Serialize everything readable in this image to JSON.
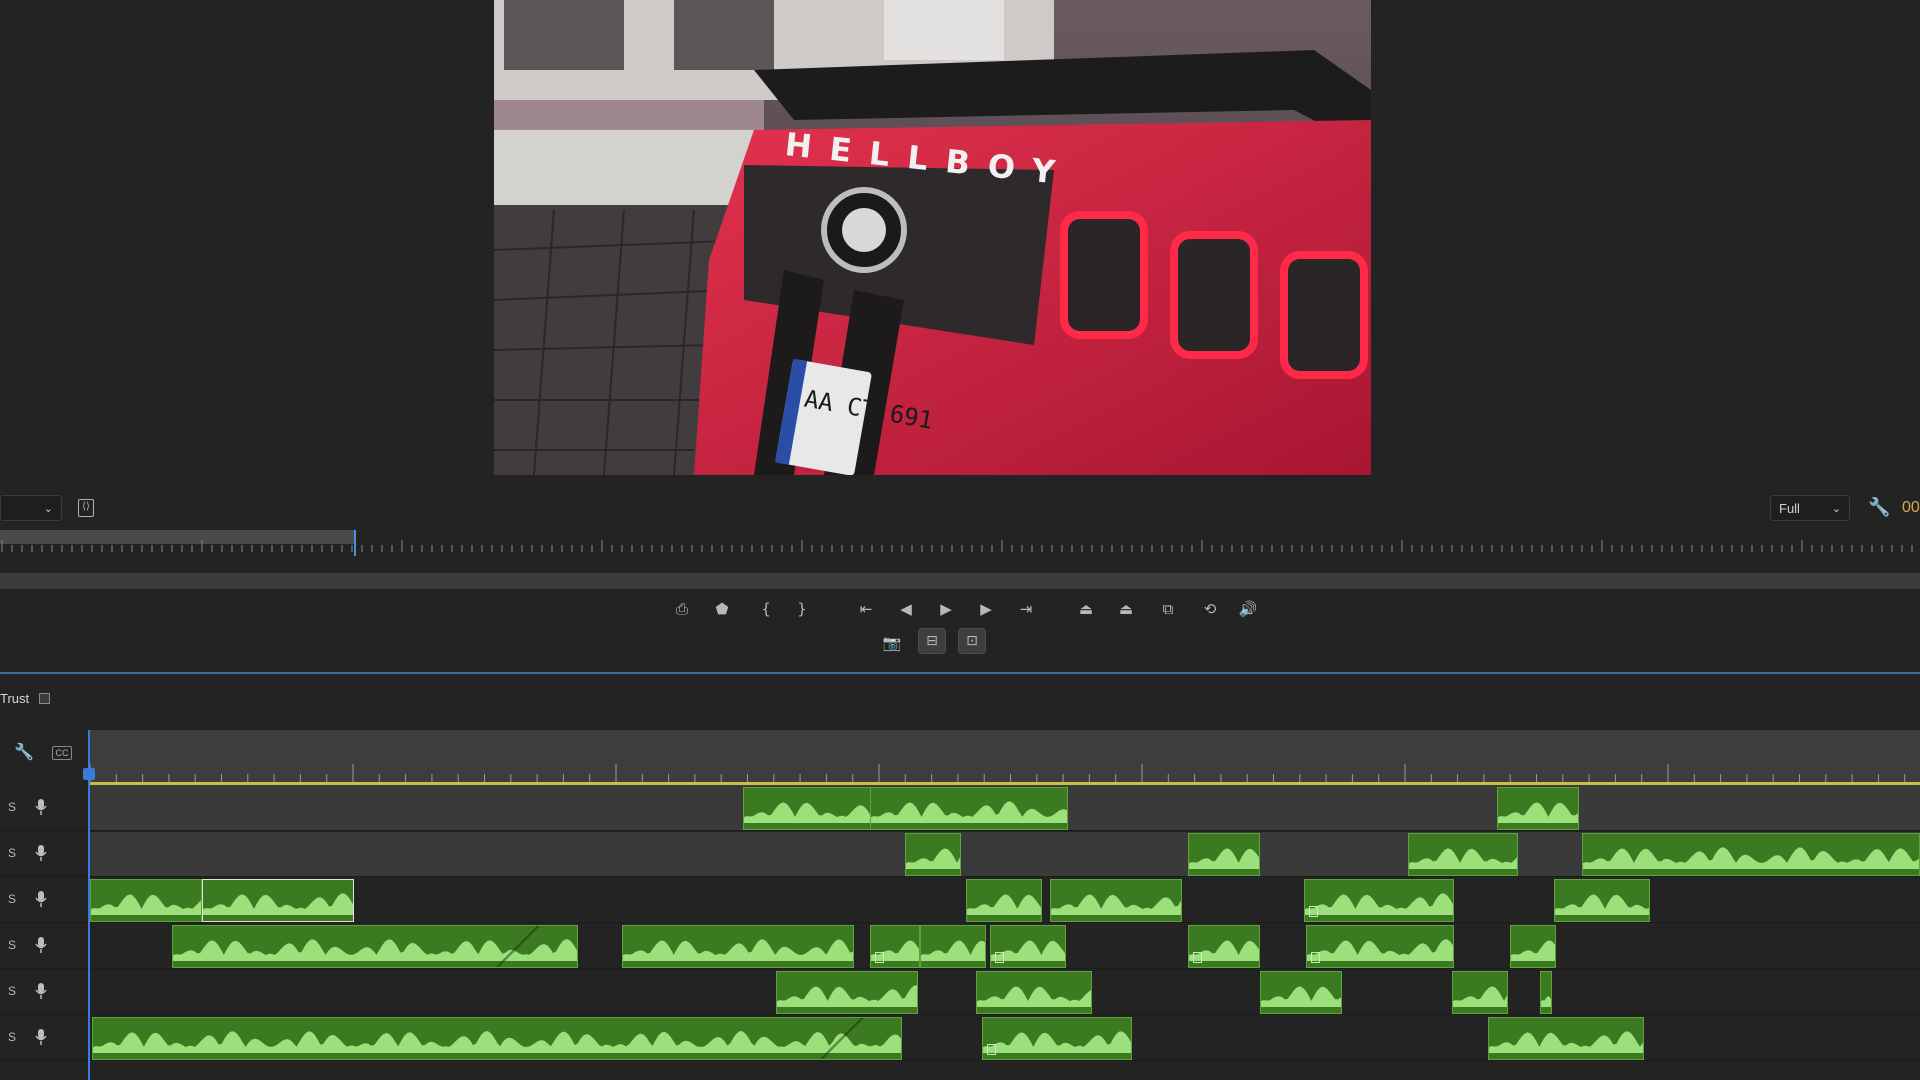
{
  "monitor": {
    "zoom_dropdown": {
      "value": ""
    },
    "resolution_dropdown": {
      "value": "Full"
    },
    "timecode": "00",
    "plate_text": "AA CT 691",
    "badge_text": "HELLBOY"
  },
  "transport": {
    "buttons": [
      {
        "name": "export-frame-button",
        "glyph": "⎙"
      },
      {
        "name": "add-marker-button",
        "glyph": "⬟"
      },
      {
        "name": "mark-in-button",
        "glyph": "{"
      },
      {
        "name": "mark-out-button",
        "glyph": "}"
      },
      {
        "name": "go-to-in-button",
        "glyph": "⇤"
      },
      {
        "name": "step-back-button",
        "glyph": "◀"
      },
      {
        "name": "play-button",
        "glyph": "▶"
      },
      {
        "name": "step-forward-button",
        "glyph": "▶"
      },
      {
        "name": "go-to-out-button",
        "glyph": "⇥"
      },
      {
        "name": "lift-button",
        "glyph": "⏏"
      },
      {
        "name": "extract-button",
        "glyph": "⏏"
      },
      {
        "name": "insert-button",
        "glyph": "⧉"
      },
      {
        "name": "overwrite-button",
        "glyph": "⟲"
      },
      {
        "name": "audio-button",
        "glyph": "🔊"
      }
    ]
  },
  "sequence": {
    "name": "Trust"
  },
  "timeline": {
    "tracks": [
      {
        "s_label": "S"
      },
      {
        "s_label": "S"
      },
      {
        "s_label": "S"
      },
      {
        "s_label": "S"
      },
      {
        "s_label": "S"
      },
      {
        "s_label": "S"
      }
    ]
  },
  "colors": {
    "clip_fill": "#3c7a22",
    "clip_border": "#5da43a",
    "waveform": "#9be07a",
    "playhead": "#3a7ad8",
    "ruler_work_area": "#c8c045"
  }
}
